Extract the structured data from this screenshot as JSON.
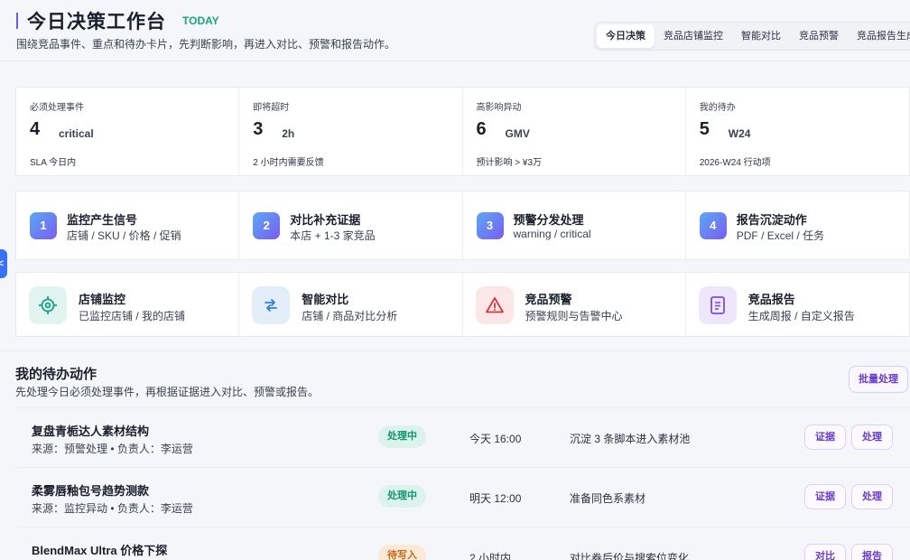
{
  "header": {
    "title": "今日决策工作台",
    "badge": "TODAY",
    "subtitle": "围绕竞品事件、重点和待办卡片，先判断影响，再进入对比、预警和报告动作。",
    "tabs": [
      {
        "label": "今日决策",
        "active": true
      },
      {
        "label": "竞品店铺监控",
        "active": false
      },
      {
        "label": "智能对比",
        "active": false
      },
      {
        "label": "竞品预警",
        "active": false
      },
      {
        "label": "竞品报告生成",
        "active": false
      }
    ]
  },
  "stats": [
    {
      "label": "必须处理事件",
      "value": "4",
      "unit": "critical",
      "foot": "SLA 今日内"
    },
    {
      "label": "即将超时",
      "value": "3",
      "unit": "2h",
      "foot": "2 小时内需要反馈"
    },
    {
      "label": "高影响异动",
      "value": "6",
      "unit": "GMV",
      "foot": "预计影响 > ¥3万"
    },
    {
      "label": "我的待办",
      "value": "5",
      "unit": "W24",
      "foot": "2026-W24 行动项"
    }
  ],
  "steps": [
    {
      "num": "1",
      "title": "监控产生信号",
      "sub": "店铺 / SKU / 价格 / 促销"
    },
    {
      "num": "2",
      "title": "对比补充证据",
      "sub": "本店 + 1-3 家竞品"
    },
    {
      "num": "3",
      "title": "预警分发处理",
      "sub": "warning / critical"
    },
    {
      "num": "4",
      "title": "报告沉淀动作",
      "sub": "PDF / Excel / 任务"
    }
  ],
  "tools": [
    {
      "icon": "target-icon",
      "title": "店铺监控",
      "sub": "已监控店铺 / 我的店铺",
      "color": "#16a085",
      "bg": "#e2f4f0"
    },
    {
      "icon": "compare-arrows-icon",
      "title": "智能对比",
      "sub": "店铺 / 商品对比分析",
      "color": "#2f7fd8",
      "bg": "#e3eef9"
    },
    {
      "icon": "warning-icon",
      "title": "竞品预警",
      "sub": "预警规则与告警中心",
      "color": "#d9393c",
      "bg": "#fbe7e7"
    },
    {
      "icon": "report-icon",
      "title": "竞品报告",
      "sub": "生成周报 / 自定义报告",
      "color": "#7a4fd6",
      "bg": "#eee6fb"
    }
  ],
  "side_tab": {
    "label": "<"
  },
  "todo": {
    "title": "我的待办动作",
    "subtitle": "先处理今日必须处理事件，再根据证据进入对比、预警或报告。",
    "batch_label": "批量处理",
    "rows": [
      {
        "name": "复盘青栀达人素材结构",
        "meta": "来源：预警处理 • 负责人：李运营",
        "status": "处理中",
        "status_tone": "green",
        "time": "今天 16:00",
        "note": "沉淀 3 条脚本进入素材池",
        "actions": [
          "证据",
          "处理"
        ]
      },
      {
        "name": "柔雾唇釉包号趋势测款",
        "meta": "来源：监控异动 • 负责人：李运营",
        "status": "处理中",
        "status_tone": "green",
        "time": "明天 12:00",
        "note": "准备同色系素材",
        "actions": [
          "证据",
          "处理"
        ]
      },
      {
        "name": "BlendMax Ultra 价格下探",
        "meta": "",
        "status": "待写入",
        "status_tone": "orange",
        "time": "2 小时内",
        "note": "对比券后价与搜索位变化",
        "actions": [
          "对比",
          "报告"
        ]
      }
    ]
  }
}
